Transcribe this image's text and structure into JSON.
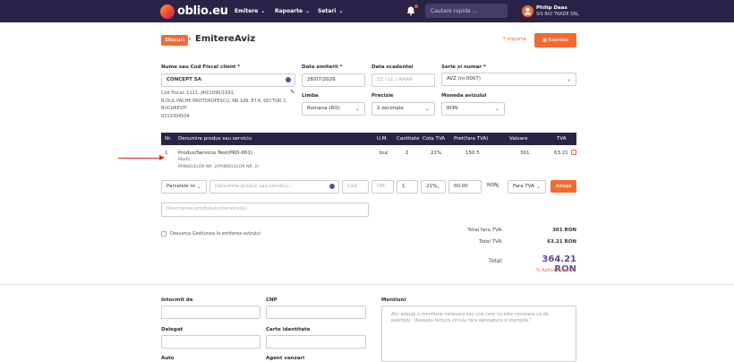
{
  "nav": {
    "brand": "oblio.eu",
    "menus": [
      "Emitere",
      "Rapoarte",
      "Setari"
    ],
    "search_placeholder": "Cautare rapida ...",
    "user_name": "Philip Daas",
    "user_company": "SIS BIO TRADE SRL",
    "bell_icon": "bell-icon"
  },
  "header": {
    "stocuri": "Stocuri",
    "crumb1": "Emitere",
    "crumb2": "Aviz",
    "sep": "›",
    "importa": "Importa",
    "rapoarte": "Rapoarte"
  },
  "client": {
    "label": "Nume sau Cod Fiscal client *",
    "value": "CONCEPT SA",
    "info": [
      "Cod Fiscal: 1111, J40/1090/1991,",
      "B-DUL PACHE PROTOPOPESCU, NR.109, ET.4, SECTOR 2,",
      "BUCURESTI",
      "0213304504"
    ]
  },
  "fields": {
    "data_emiterii_label": "Data emiterii *",
    "data_emiterii": "28/07/2026",
    "data_scadentei_label": "Data scadentei",
    "data_scadentei_placeholder": "ZZ / LL / AAAA",
    "serie_label": "Serie si numar *",
    "serie": "AVZ (nr.0007)",
    "limba_label": "Limba",
    "limba": "Romana (RO)",
    "precizie_label": "Precizie",
    "precizie": "2 zecimale",
    "moneda_label": "Moneda avizului",
    "moneda": "RON"
  },
  "table": {
    "headers": [
      "Nr.",
      "Denumire produs sau serviciu",
      "U.M.",
      "Cantitate",
      "Cota TVA",
      "Pret(fara TVA)",
      "Valoare",
      "TVA"
    ],
    "row": {
      "nr": "1",
      "name": "Produs/Serviciu Test(PRD-001)",
      "type": "Marfa",
      "sub": "PANSELELOR NR. 2(PANSELELOR NR. 2)",
      "um": "buc",
      "qty": "2",
      "cota": "21%",
      "pret": "150.5",
      "valoare": "301",
      "tva": "63.21"
    }
  },
  "add_row": {
    "cod_select": "Parcelele nr.",
    "name_placeholder": "Denumire produs sau serviciu...",
    "cod_placeholder": "Cod",
    "um_placeholder": "UM",
    "qty": "1",
    "cota": "21%",
    "pret": "00.00",
    "moneda": "RON",
    "tva_select": "Fara TVA",
    "adauga": "Adauga",
    "desc_placeholder": "Descrierea produsului/serviciului"
  },
  "options": {
    "checkbox_label": "Descarca Gestiunea la emiterea avizului"
  },
  "totals": {
    "fara_tva_label": "Total fara TVA:",
    "fara_tva": "301 RON",
    "tva_label": "Total TVA:",
    "tva": "63.21 RON",
    "total_label": "Total:",
    "total": "364.21 RON",
    "discount": "% Aplica Discount"
  },
  "bottom": {
    "intocmit": "Intocmit de",
    "cnp": "CNP",
    "delegat": "Delegat",
    "carte": "Carte identitate",
    "auto": "Auto",
    "agent": "Agent vanzari",
    "mentiuni": "Mentiuni",
    "note": "Aici adaugi o mentiune necesara sau una care nu este necesara ca de exemplu: \"Aceasta factura circula fara semnatura si stampila.\""
  }
}
